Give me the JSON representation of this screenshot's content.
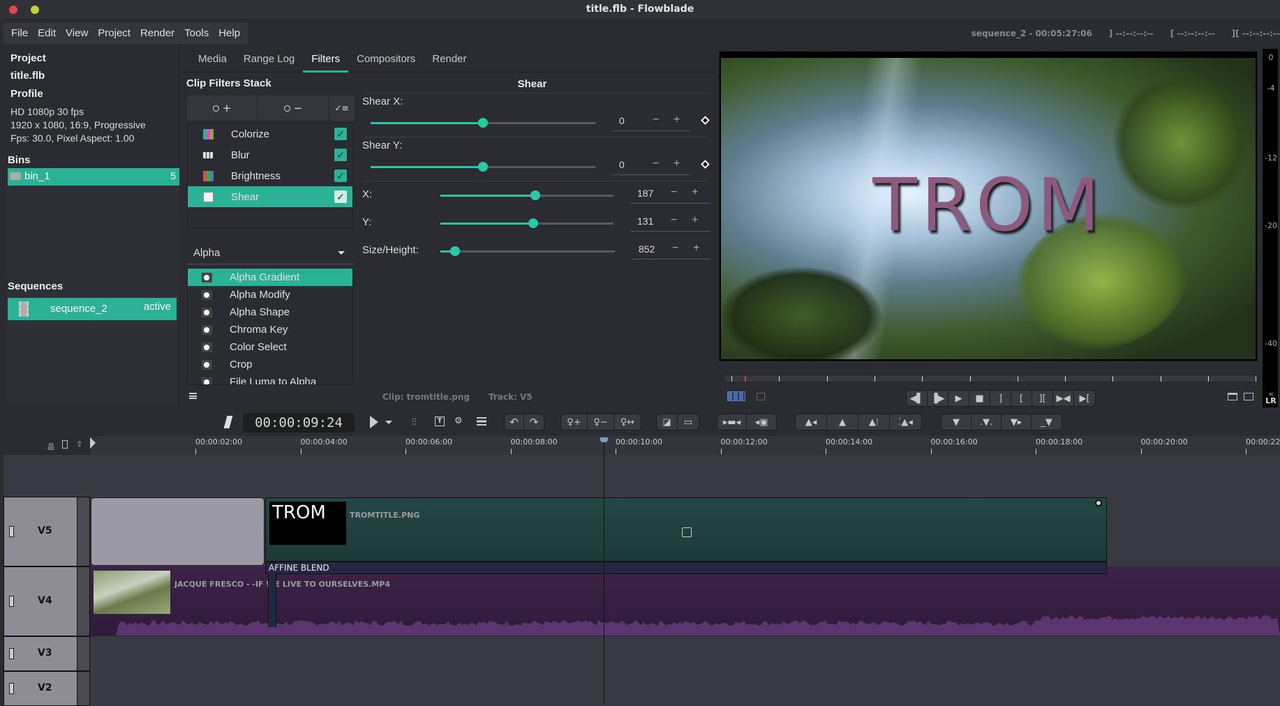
{
  "window": {
    "title": "title.flb - Flowblade",
    "close_color": "#e2474b",
    "minimize_color": "#c4cf3e"
  },
  "menu": [
    "File",
    "Edit",
    "View",
    "Project",
    "Render",
    "Tools",
    "Help"
  ],
  "sequence_info": {
    "name_time": "sequence_2  -  00:05:27:06",
    "mark_out": "] --:--:--:--",
    "mark_in": "[ --:--:--:--",
    "length": "][ --:--:--:--"
  },
  "project": {
    "heading": "Project",
    "file": "title.flb",
    "profile_heading": "Profile",
    "profile_name": "HD 1080p 30 fps",
    "profile_size": "1920 x 1080, 16:9, Progressive",
    "profile_fps": "Fps: 30.0, Pixel Aspect: 1.00",
    "bins_heading": "Bins",
    "bins": [
      {
        "name": "bin_1",
        "count": "5"
      }
    ],
    "sequences_heading": "Sequences",
    "sequences": [
      {
        "name": "sequence_2",
        "status": "active"
      }
    ]
  },
  "tabs": [
    {
      "label": "Media",
      "active": false
    },
    {
      "label": "Range Log",
      "active": false
    },
    {
      "label": "Filters",
      "active": true
    },
    {
      "label": "Compositors",
      "active": false
    },
    {
      "label": "Render",
      "active": false
    }
  ],
  "filters_stack": {
    "heading": "Clip Filters Stack",
    "add_label": "+",
    "remove_label": "−",
    "items": [
      {
        "name": "Colorize",
        "enabled": true,
        "selected": false
      },
      {
        "name": "Blur",
        "enabled": true,
        "selected": false
      },
      {
        "name": "Brightness",
        "enabled": true,
        "selected": false
      },
      {
        "name": "Shear",
        "enabled": true,
        "selected": true
      }
    ]
  },
  "filter_category": {
    "selected": "Alpha",
    "items": [
      "Alpha Gradient",
      "Alpha Modify",
      "Alpha Shape",
      "Chroma Key",
      "Color Select",
      "Crop",
      "File Luma to Alpha"
    ],
    "selected_index": 0
  },
  "filter_editor": {
    "title": "Shear",
    "params": [
      {
        "label": "Shear X:",
        "value": "0",
        "fraction": 0.5,
        "keyframed": true
      },
      {
        "label": "Shear Y:",
        "value": "0",
        "fraction": 0.5,
        "keyframed": true
      },
      {
        "label": "X:",
        "value": "187",
        "fraction": 0.55,
        "keyframed": false
      },
      {
        "label": "Y:",
        "value": "131",
        "fraction": 0.535,
        "keyframed": false
      },
      {
        "label": "Size/Height:",
        "value": "852",
        "fraction": 0.085,
        "keyframed": false
      }
    ],
    "minus": "−",
    "plus": "+",
    "clip_info": "Clip: tromtitle.png",
    "track_info": "Track: V5"
  },
  "monitor": {
    "overlay_text": "TROM",
    "overlay_color": "#8b5a7e"
  },
  "meter": {
    "ticks": [
      "0",
      "-4",
      "-12",
      "-20",
      "-40"
    ],
    "infinity": "∞",
    "channels": "LR"
  },
  "timecode": "00:00:09:24",
  "ruler": {
    "labels": [
      "00:00:02:00",
      "00:00:04:00",
      "00:00:06:00",
      "00:00:08:00",
      "00:00:10:00",
      "00:00:12:00",
      "00:00:14:00",
      "00:00:16:00",
      "00:00:18:00",
      "00:00:20:00",
      "00:00:22"
    ]
  },
  "tracks": [
    {
      "name": "V5"
    },
    {
      "name": "V4"
    },
    {
      "name": "V3"
    },
    {
      "name": "V2"
    }
  ],
  "clips": {
    "title_clip": {
      "name": "TROMTITLE.PNG",
      "thumb_text": "TROM"
    },
    "compositor": {
      "name": "AFFINE BLEND"
    },
    "video_clip": {
      "name": "JACQUE FRESCO - -IF WE LIVE TO OURSELVES.MP4"
    }
  },
  "colors": {
    "accent": "#2bb196",
    "title_clip": "#1f3e3e",
    "video_clip": "#3a2244",
    "audio_wave": "#5b3570"
  }
}
